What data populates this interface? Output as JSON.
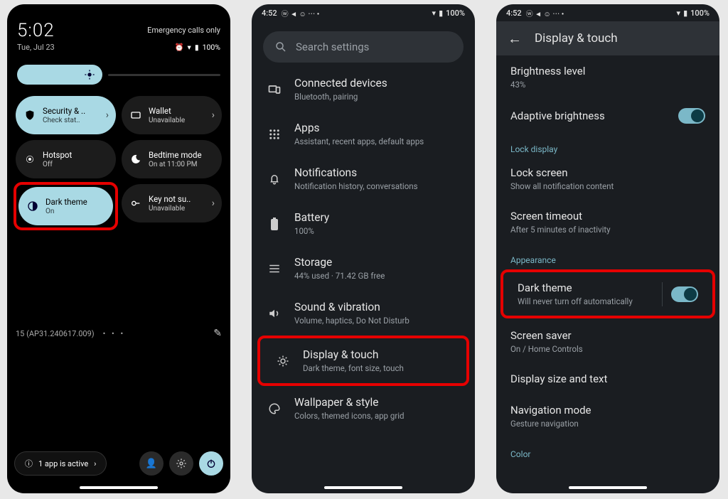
{
  "panel1": {
    "time": "5:02",
    "date": "Tue, Jul 23",
    "emergency": "Emergency calls only",
    "battery": "100%",
    "brightness_icon": "brightness-icon",
    "tiles": [
      {
        "title": "Security & ..",
        "subtitle": "Check stat..",
        "active": true,
        "has_chevron": true,
        "icon": "shield-icon"
      },
      {
        "title": "Wallet",
        "subtitle": "Unavailable",
        "active": false,
        "has_chevron": true,
        "icon": "wallet-icon"
      },
      {
        "title": "Hotspot",
        "subtitle": "Off",
        "active": false,
        "has_chevron": false,
        "icon": "hotspot-icon"
      },
      {
        "title": "Bedtime mode",
        "subtitle": "On at 11:00 PM",
        "active": false,
        "has_chevron": false,
        "icon": "bedtime-icon"
      },
      {
        "title": "Dark theme",
        "subtitle": "On",
        "active": true,
        "has_chevron": false,
        "icon": "contrast-icon",
        "highlighted": true
      },
      {
        "title": "Key not su..",
        "subtitle": "Unavailable",
        "active": false,
        "has_chevron": true,
        "icon": "key-icon"
      }
    ],
    "build": "15 (AP31.240617.009)",
    "chip": "1 app is active"
  },
  "panel2": {
    "status_time": "4:52",
    "battery": "100%",
    "search_placeholder": "Search settings",
    "items": [
      {
        "title": "Connected devices",
        "subtitle": "Bluetooth, pairing",
        "icon": "devices-icon"
      },
      {
        "title": "Apps",
        "subtitle": "Assistant, recent apps, default apps",
        "icon": "apps-icon"
      },
      {
        "title": "Notifications",
        "subtitle": "Notification history, conversations",
        "icon": "bell-icon"
      },
      {
        "title": "Battery",
        "subtitle": "100%",
        "icon": "battery-icon"
      },
      {
        "title": "Storage",
        "subtitle": "44% used · 71.42 GB free",
        "icon": "storage-icon"
      },
      {
        "title": "Sound & vibration",
        "subtitle": "Volume, haptics, Do Not Disturb",
        "icon": "sound-icon"
      },
      {
        "title": "Display & touch",
        "subtitle": "Dark theme, font size, touch",
        "icon": "display-icon",
        "highlighted": true
      },
      {
        "title": "Wallpaper & style",
        "subtitle": "Colors, themed icons, app grid",
        "icon": "palette-icon"
      }
    ]
  },
  "panel3": {
    "status_time": "4:52",
    "battery": "100%",
    "page_title": "Display & touch",
    "rows": [
      {
        "title": "Brightness level",
        "subtitle": "43%"
      },
      {
        "title": "Adaptive brightness",
        "subtitle": "",
        "toggle": true
      }
    ],
    "section1": "Lock display",
    "lockrows": [
      {
        "title": "Lock screen",
        "subtitle": "Show all notification content"
      },
      {
        "title": "Screen timeout",
        "subtitle": "After 5 minutes of inactivity"
      }
    ],
    "section2": "Appearance",
    "approws": [
      {
        "title": "Dark theme",
        "subtitle": "Will never turn off automatically",
        "toggle": true,
        "highlighted": true
      },
      {
        "title": "Screen saver",
        "subtitle": "On / Home Controls"
      },
      {
        "title": "Display size and text",
        "subtitle": ""
      },
      {
        "title": "Navigation mode",
        "subtitle": "Gesture navigation"
      }
    ],
    "section3": "Color"
  }
}
